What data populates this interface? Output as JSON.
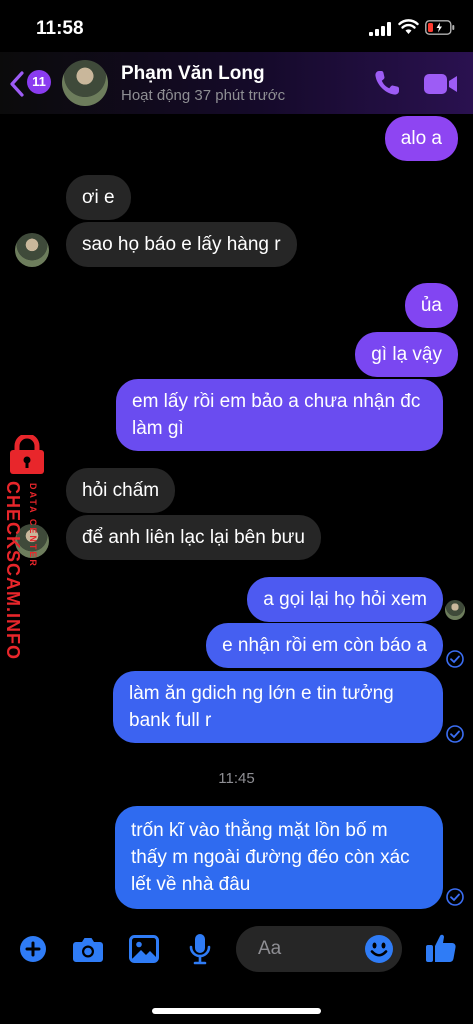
{
  "status_bar": {
    "time": "11:58"
  },
  "header": {
    "unread_count": "11",
    "contact_name": "Phạm Văn Long",
    "activity": "Hoạt động 37 phút trước"
  },
  "messages": [
    {
      "text": "alo a",
      "dir": "out"
    },
    {
      "text": "ơi e",
      "dir": "in"
    },
    {
      "text": "sao họ báo e lấy hàng r",
      "dir": "in"
    },
    {
      "text": "ủa",
      "dir": "out"
    },
    {
      "text": "gì lạ vậy",
      "dir": "out"
    },
    {
      "text": "em lấy rồi em bảo a chưa nhận đc làm gì",
      "dir": "out"
    },
    {
      "text": "hỏi chấm",
      "dir": "in"
    },
    {
      "text": "để anh liên lạc lại bên bưu",
      "dir": "in"
    },
    {
      "text": "a gọi lại họ hỏi xem",
      "dir": "out"
    },
    {
      "text": "e nhận rồi em còn báo a",
      "dir": "out"
    },
    {
      "text": "làm ăn gdich ng lớn e tin tưởng bank full r",
      "dir": "out"
    },
    {
      "text": "trốn kĩ vào thằng mặt lồn bố m thấy m ngoài đường đéo còn xác lết về nhà đâu",
      "dir": "out"
    }
  ],
  "timestamp": "11:45",
  "composer": {
    "placeholder": "Aa"
  },
  "watermark": {
    "brand": "CHECKSCAM.INFO",
    "tagline": "DATA CENTER"
  },
  "colors": {
    "outgoing_top": "#8e45f2",
    "outgoing_bottom": "#2f6bf0",
    "incoming": "#262626",
    "accent_header": "#9d5cf5",
    "accent_toolbar": "#2f7cf6",
    "watermark": "#e8262b"
  },
  "icons": [
    "back-chevron-icon",
    "phone-icon",
    "video-camera-icon",
    "plus-icon",
    "camera-icon",
    "image-icon",
    "microphone-icon",
    "emoji-icon",
    "thumbs-up-icon",
    "seen-check-icon"
  ]
}
